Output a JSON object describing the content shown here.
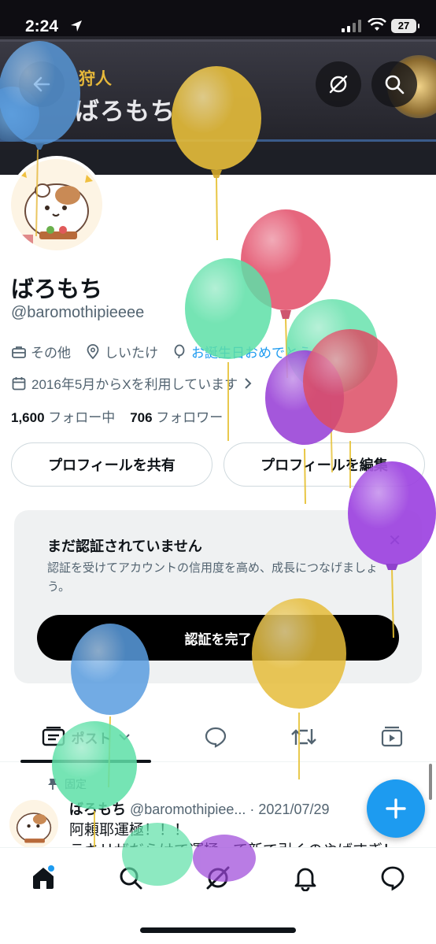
{
  "status_bar": {
    "time": "2:24",
    "battery": "27"
  },
  "banner": {
    "title_fragment": "狩人",
    "name_fragment": "ばろもち"
  },
  "profile": {
    "name": "ばろもち",
    "handle": "@baromothipieeee",
    "category": "その他",
    "location": "しいたけ",
    "birthday_link": "お誕生日おめでとう",
    "joined": "2016年5月からXを利用しています",
    "following_count": "1,600",
    "following_label": "フォロー中",
    "followers_count": "706",
    "followers_label": "フォロワー"
  },
  "actions": {
    "share": "プロフィールを共有",
    "edit": "プロフィールを編集"
  },
  "verify_card": {
    "title": "まだ認証されていません",
    "description": "認証を受けてアカウントの信用度を高め、成長につなげましょう。",
    "button": "認証を完了"
  },
  "tabs": [
    {
      "label": "ポスト",
      "icon": "posts-icon",
      "active": true
    },
    {
      "label": "",
      "icon": "replies-icon"
    },
    {
      "label": "",
      "icon": "reposts-icon"
    },
    {
      "label": "",
      "icon": "media-icon"
    }
  ],
  "pinned_post": {
    "pinned_label": "固定",
    "author": "ばろもち",
    "handle": "@baromothipiee...",
    "separator": "·",
    "date": "2021/07/29",
    "line1": "阿頼耶運極！！！",
    "line2": "ラキリザだらけで運極って新で引くのやばすぎ！"
  },
  "colors": {
    "accent": "#1d9bf0",
    "text": "#0f1419",
    "muted": "#536471"
  }
}
